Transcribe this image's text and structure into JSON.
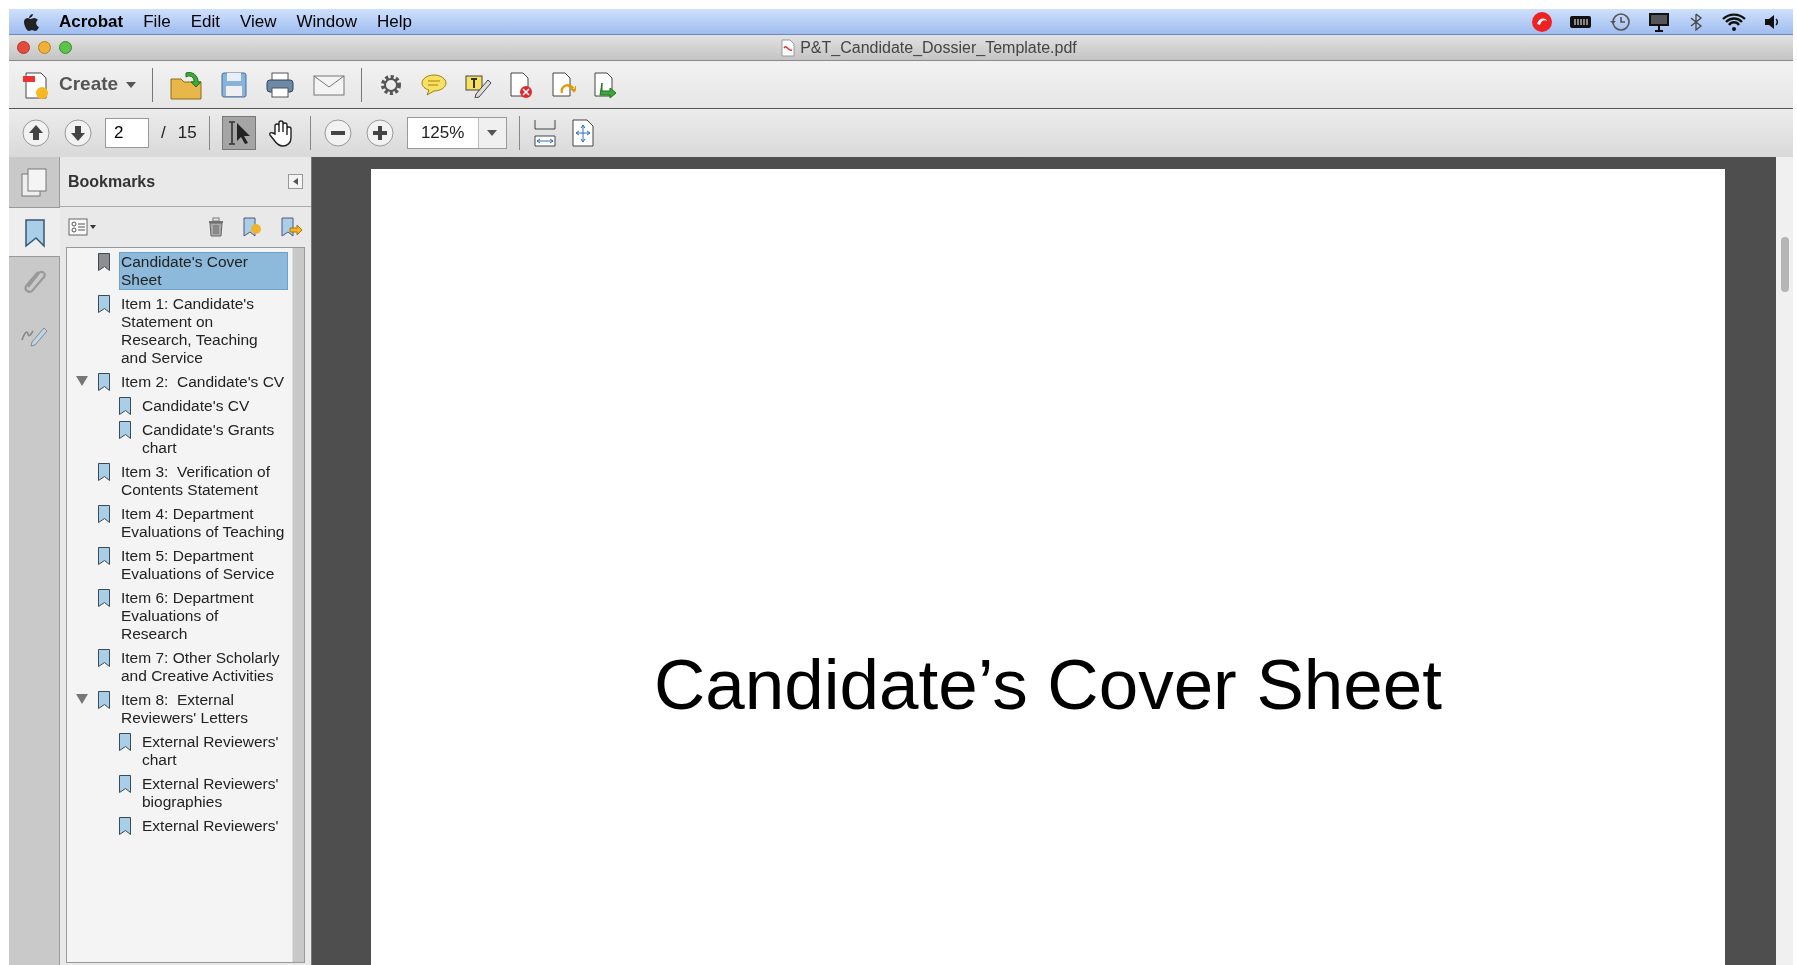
{
  "menu_bar": {
    "app_name": "Acrobat",
    "items": [
      "File",
      "Edit",
      "View",
      "Window",
      "Help"
    ]
  },
  "window": {
    "title": "P&T_Candidate_Dossier_Template.pdf"
  },
  "toolbar": {
    "create_label": "Create"
  },
  "navigation": {
    "page": "2",
    "separator": "/",
    "page_count": "15",
    "zoom": "125%"
  },
  "tools": [
    {
      "kind": "select",
      "selected": true
    },
    {
      "kind": "hand",
      "selected": false
    }
  ],
  "sidebar": {
    "title": "Bookmarks",
    "tabs": [
      {
        "kind": "pages",
        "selected": false
      },
      {
        "kind": "bookmarks",
        "selected": true
      },
      {
        "kind": "attachments",
        "selected": false
      },
      {
        "kind": "signatures",
        "selected": false
      }
    ]
  },
  "bookmarks": [
    {
      "label": "Candidate's Cover Sheet",
      "selected": true
    },
    {
      "label": "Item 1: Candidate's Statement on Research, Teaching and Service",
      "selected": false
    },
    {
      "label": "Item 2:  Candidate's CV",
      "selected": false,
      "expanded": true,
      "children": [
        {
          "label": "Candidate's CV",
          "selected": false
        },
        {
          "label": "Candidate's Grants chart",
          "selected": false
        }
      ]
    },
    {
      "label": "Item 3:  Verification of Contents Statement",
      "selected": false
    },
    {
      "label": "Item 4: Department Evaluations of Teaching",
      "selected": false
    },
    {
      "label": "Item 5: Department Evaluations of Service",
      "selected": false
    },
    {
      "label": "Item 6: Department Evaluations of Research",
      "selected": false
    },
    {
      "label": "Item 7: Other Scholarly and Creative Activities",
      "selected": false
    },
    {
      "label": "Item 8:  External Reviewers' Letters",
      "selected": false,
      "expanded": true,
      "children": [
        {
          "label": "External Reviewers' chart",
          "selected": false
        },
        {
          "label": "External Reviewers' biographies",
          "selected": false
        },
        {
          "label": "External Reviewers'",
          "selected": false
        }
      ]
    }
  ],
  "document": {
    "heading": "Candidate’s Cover Sheet"
  }
}
